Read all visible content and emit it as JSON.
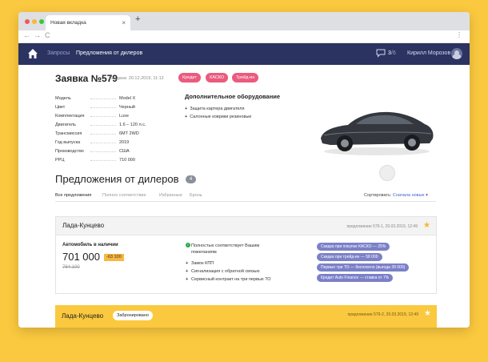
{
  "browser": {
    "tab_title": "Новая вкладка",
    "tab_close": "×",
    "new_tab": "+",
    "back": "←",
    "forward": "→",
    "reload": "C",
    "menu": "⋮"
  },
  "appbar": {
    "nav": [
      "Запросы",
      "Предложения от дилеров"
    ],
    "messages_read": "3",
    "messages_total": "/6",
    "user_name": "Кирилл Морозов"
  },
  "request": {
    "title": "Заявка №579",
    "created": "Создана: 20.12.2019, 11:12",
    "tags": [
      "Кредит",
      "КАСКО",
      "Трейд-ин"
    ],
    "specs": [
      {
        "key": "Модель",
        "value": "Model X"
      },
      {
        "key": "Цвет",
        "value": "Черный"
      },
      {
        "key": "Комплектация",
        "value": "Luxe"
      },
      {
        "key": "Двигатель",
        "value": "1.6 – 120 л.с."
      },
      {
        "key": "Трансмиссия",
        "value": "6МТ 2WD"
      },
      {
        "key": "Год выпуска",
        "value": "2019"
      },
      {
        "key": "Производство",
        "value": "США"
      },
      {
        "key": "РРЦ",
        "value": "710 000"
      }
    ],
    "equipment_title": "Дополнительное оборудование",
    "equipment": [
      "Защита картера двигателя",
      "Салонные коврики резиновые"
    ]
  },
  "offers": {
    "title": "Предложения от дилеров",
    "count": "4",
    "tabs": [
      "Все предложения",
      "Полное соответствие",
      "Избранные",
      "Бронь"
    ],
    "sort_label": "Сортировать:",
    "sort_value": "Сначала новые ▾"
  },
  "card1": {
    "dealer": "Лада-Кунцево",
    "meta": "предложение 579-1, 20.03.2019, 12:49",
    "availability": "Автомобиль в наличии",
    "price": "701 000",
    "discount": "-63 100",
    "old_price": "764 100",
    "match": "Полностью соответствует Вашим пожеланиям",
    "features": [
      "Замок КПП",
      "Сигнализация с обратной связью",
      "Сервисный контракт на три первых ТО"
    ],
    "bonuses": [
      "Скидка при покупке КАСКО — 25%",
      "Скидка при трейд-ин — 58 000",
      "Первые три ТО — бесплатно (выгода 39 000)",
      "Кредит Auto Finance — ставка от 7%"
    ]
  },
  "card2": {
    "dealer": "Лада-Кунцево",
    "badge": "Забронировано",
    "meta": "предложение 579-2, 20.03.2019, 12:49"
  },
  "icons": {
    "star": "★",
    "plus": "+",
    "check": "✓"
  },
  "colors": {
    "background": "#fbc93f",
    "appbar": "#2b3361",
    "tag": "#ea5b7e",
    "bonus_pill": "#7b80c8",
    "discount": "#f9b73f",
    "star": "#f5b82e"
  }
}
